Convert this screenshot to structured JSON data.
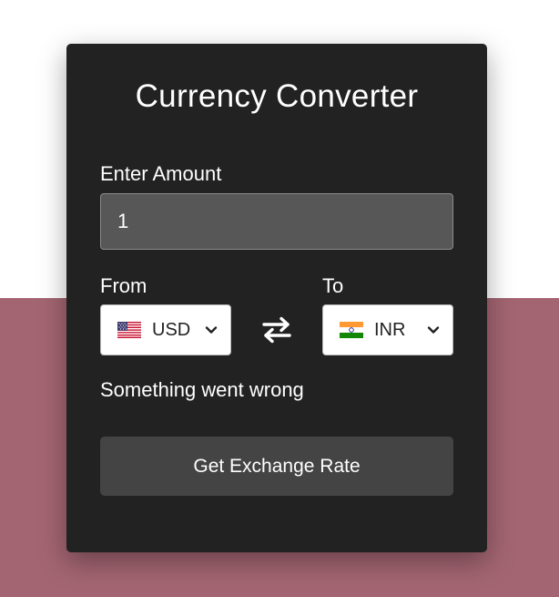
{
  "converter": {
    "title": "Currency Converter",
    "amount_label": "Enter Amount",
    "amount_value": "1",
    "from_label": "From",
    "to_label": "To",
    "from_currency": {
      "code": "USD",
      "flag": "us-flag-icon"
    },
    "to_currency": {
      "code": "INR",
      "flag": "in-flag-icon"
    },
    "message": "Something went wrong",
    "button_label": "Get Exchange Rate"
  },
  "colors": {
    "page_top": "#ffffff",
    "page_bottom": "#a36572",
    "card_background": "#222222",
    "input_background": "#575757",
    "button_background": "#444444"
  }
}
